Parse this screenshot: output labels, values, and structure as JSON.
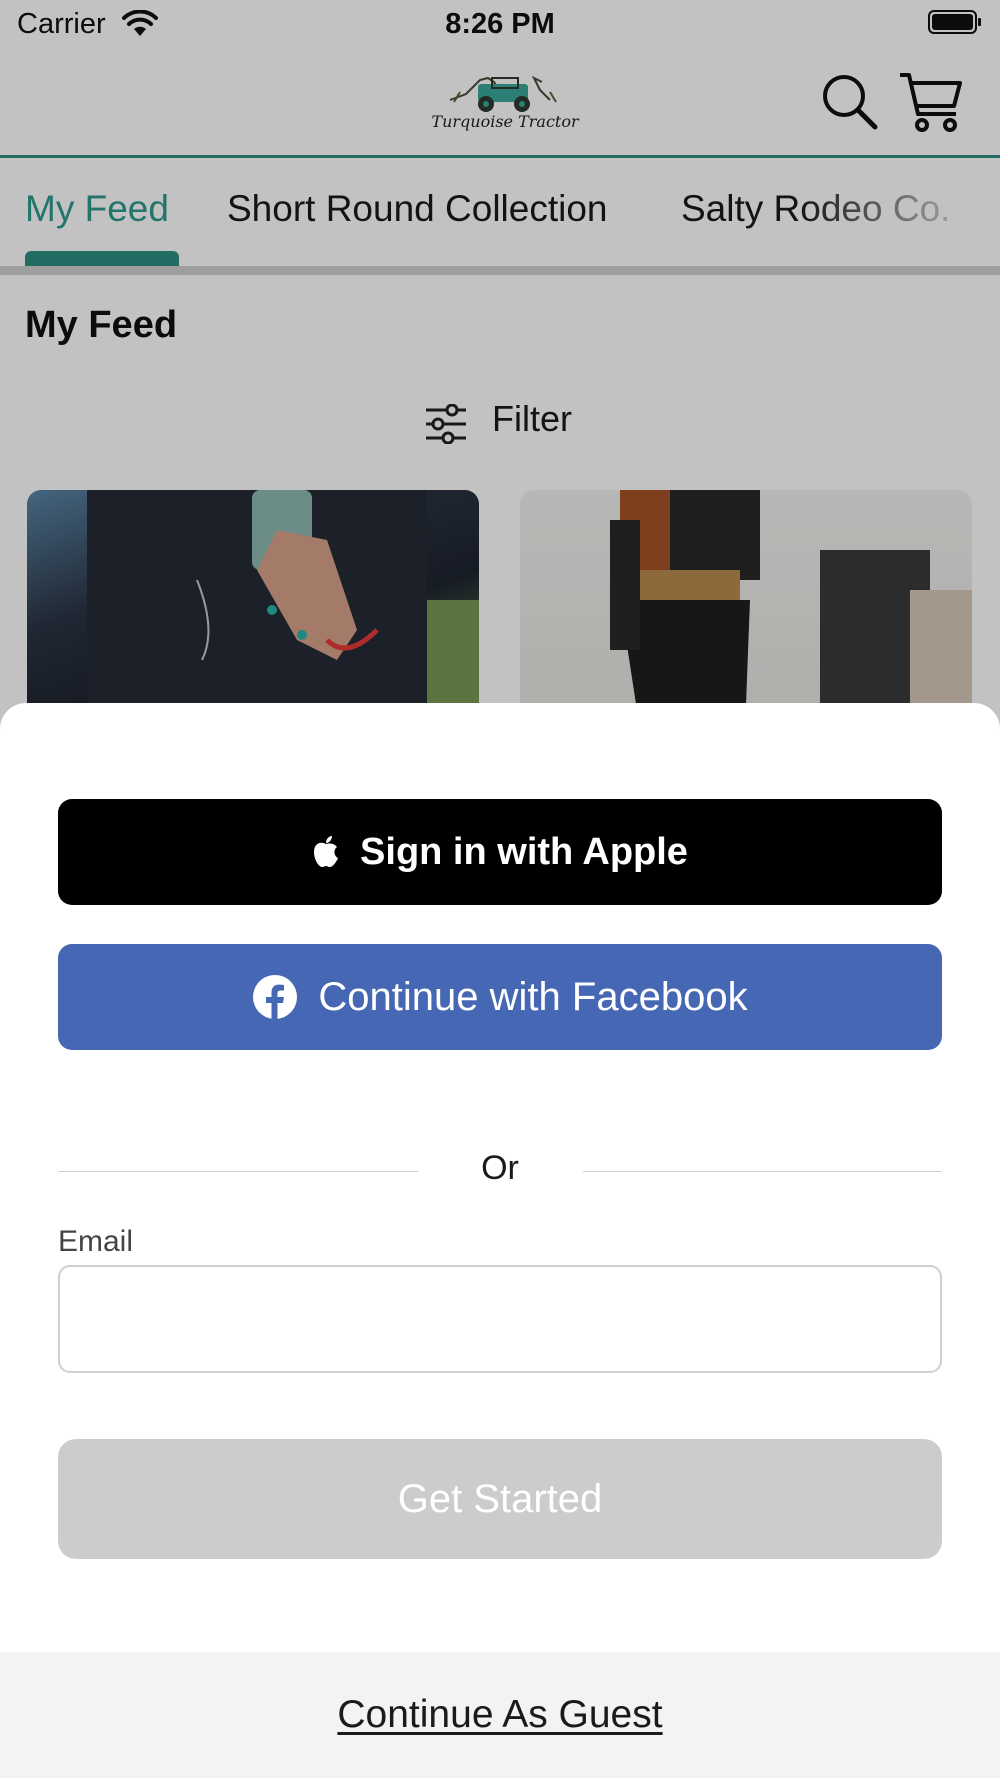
{
  "status_bar": {
    "carrier": "Carrier",
    "time": "8:26 PM"
  },
  "header": {
    "logo_text": "Turquoise Tractor",
    "icons": [
      "search-icon",
      "cart-icon"
    ]
  },
  "tabs": [
    {
      "label": "My Feed",
      "active": true
    },
    {
      "label": "Short Round Collection",
      "active": false
    },
    {
      "label": "Salty Rodeo Co.",
      "active": false
    }
  ],
  "feed": {
    "title": "My Feed",
    "filter_label": "Filter"
  },
  "signin_sheet": {
    "apple_label": "Sign in with Apple",
    "facebook_label": "Continue with Facebook",
    "or_label": "Or",
    "email_label": "Email",
    "email_value": "",
    "email_placeholder": "",
    "get_started_label": "Get Started",
    "guest_label": "Continue As Guest"
  },
  "colors": {
    "accent": "#2e9a8e",
    "facebook": "#4667b3",
    "apple": "#000000",
    "disabled_button": "#cccccc"
  }
}
